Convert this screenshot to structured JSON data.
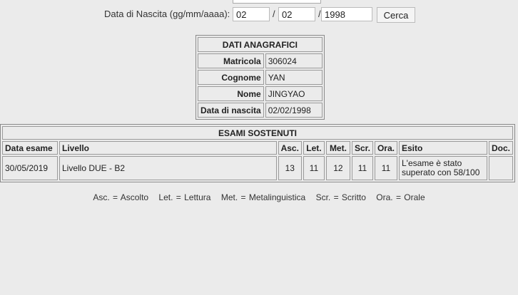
{
  "search": {
    "dob_label": "Data di Nascita (gg/mm/aaaa):",
    "day": "02",
    "month": "02",
    "year": "1998",
    "sep1": "/",
    "sep2": "/",
    "button": "Cerca"
  },
  "anagrafici": {
    "title": "DATI ANAGRAFICI",
    "rows": [
      {
        "label": "Matricola",
        "value": "306024"
      },
      {
        "label": "Cognome",
        "value": "YAN"
      },
      {
        "label": "Nome",
        "value": "JINGYAO"
      },
      {
        "label": "Data di nascita",
        "value": "02/02/1998"
      }
    ]
  },
  "esami": {
    "title": "ESAMI SOSTENUTI",
    "headers": [
      "Data esame",
      "Livello",
      "Asc.",
      "Let.",
      "Met.",
      "Scr.",
      "Ora.",
      "Esito",
      "Doc."
    ],
    "rows": [
      {
        "data": "30/05/2019",
        "livello": "Livello DUE - B2",
        "asc": "13",
        "let": "11",
        "met": "12",
        "scr": "11",
        "ora": "11",
        "esito": "L'esame è stato superato con 58/100",
        "doc": ""
      }
    ]
  },
  "legend": [
    "Asc. = Ascolto",
    "Let. = Lettura",
    "Met. = Metalinguistica",
    "Scr. = Scritto",
    "Ora. = Orale"
  ]
}
